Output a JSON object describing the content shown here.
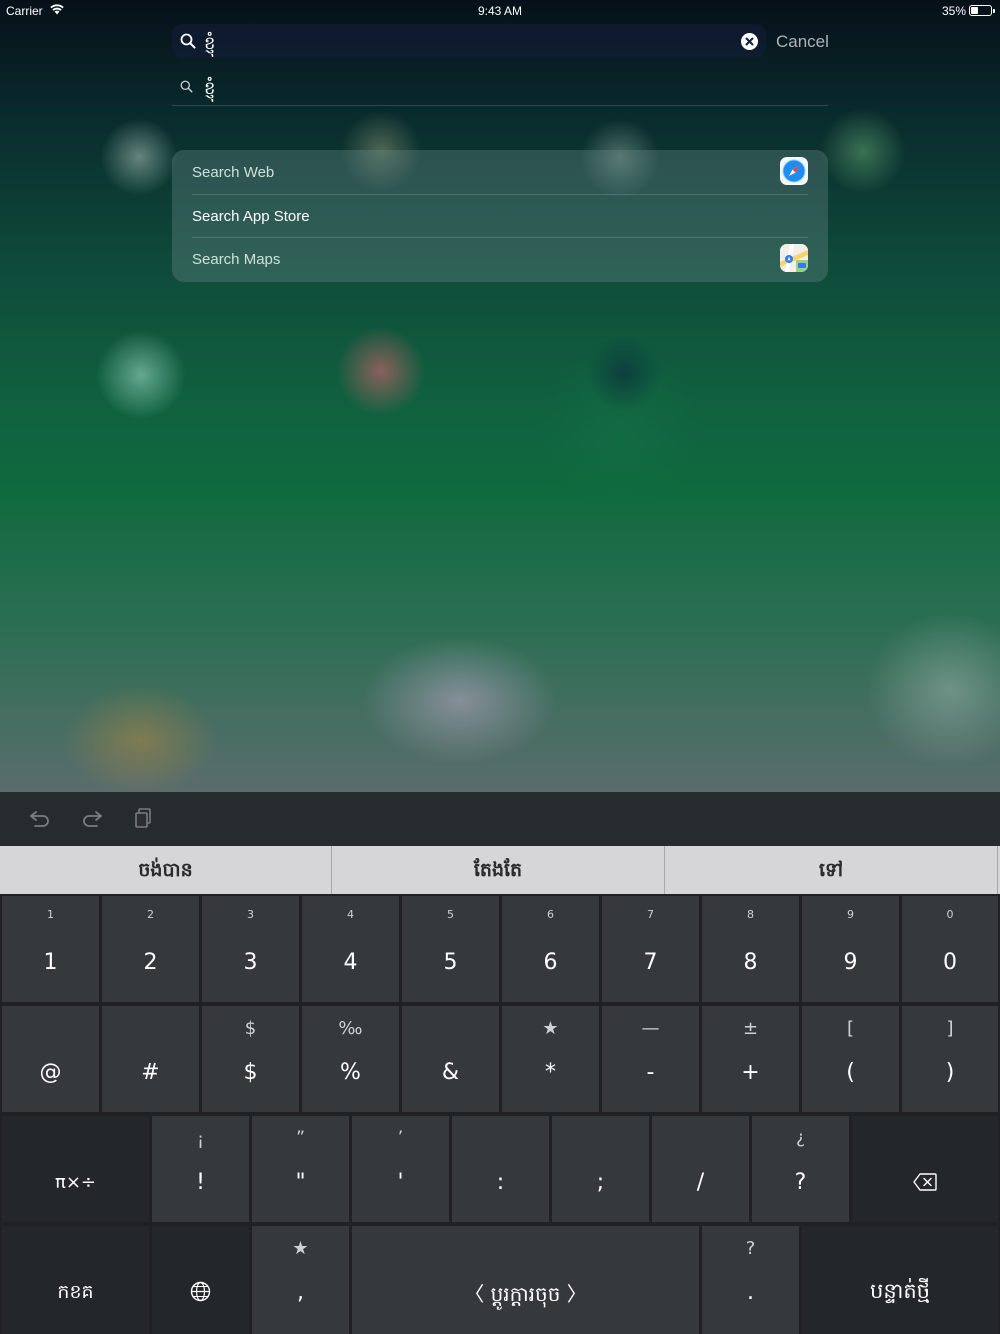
{
  "status_bar": {
    "carrier": "Carrier",
    "time": "9:43 AM",
    "battery": "35%"
  },
  "search": {
    "value": "ខ្ញុំ",
    "cancel_label": "Cancel"
  },
  "suggestion": {
    "text": "ខ្ញុំ"
  },
  "results": [
    {
      "label": "Search Web",
      "icon": "safari-icon"
    },
    {
      "label": "Search App Store",
      "icon": ""
    },
    {
      "label": "Search Maps",
      "icon": "maps-icon"
    }
  ],
  "toolbar": {
    "undo": "undo-icon",
    "redo": "redo-icon",
    "paste": "paste-icon"
  },
  "candidates": [
    "ចង់បាន",
    "តែងតែ",
    "ទៅ"
  ],
  "keyboard": {
    "row1": [
      {
        "hint": "1",
        "main": "1"
      },
      {
        "hint": "2",
        "main": "2"
      },
      {
        "hint": "3",
        "main": "3"
      },
      {
        "hint": "4",
        "main": "4"
      },
      {
        "hint": "5",
        "main": "5"
      },
      {
        "hint": "6",
        "main": "6"
      },
      {
        "hint": "7",
        "main": "7"
      },
      {
        "hint": "8",
        "main": "8"
      },
      {
        "hint": "9",
        "main": "9"
      },
      {
        "hint": "0",
        "main": "0"
      }
    ],
    "row2": [
      {
        "hint": "",
        "main": "@"
      },
      {
        "hint": "",
        "main": "#"
      },
      {
        "hint": "$",
        "main": "$"
      },
      {
        "hint": "‰",
        "main": "%"
      },
      {
        "hint": "",
        "main": "&"
      },
      {
        "hint": "★",
        "main": "*"
      },
      {
        "hint": "—",
        "main": "-"
      },
      {
        "hint": "±",
        "main": "+"
      },
      {
        "hint": "[",
        "main": "("
      },
      {
        "hint": "]",
        "main": ")"
      }
    ],
    "row3": {
      "mode_key": "π×÷",
      "keys": [
        {
          "hint": "¡",
          "main": "!"
        },
        {
          "hint": "”",
          "main": "\""
        },
        {
          "hint": "’",
          "main": "'"
        },
        {
          "hint": "",
          "main": ":"
        },
        {
          "hint": "",
          "main": ";"
        },
        {
          "hint": "",
          "main": "/"
        },
        {
          "hint": "¿",
          "main": "?"
        }
      ],
      "delete_icon": "delete-icon"
    },
    "row4": {
      "abc_key": "កខគ",
      "globe_icon": "globe-icon",
      "comma": {
        "hint": "★",
        "main": ","
      },
      "space": "〈 ប្តូរក្តារចុច 〉",
      "period": {
        "hint": "?",
        "main": "."
      },
      "return": "បន្ទាត់ថ្មី"
    }
  }
}
